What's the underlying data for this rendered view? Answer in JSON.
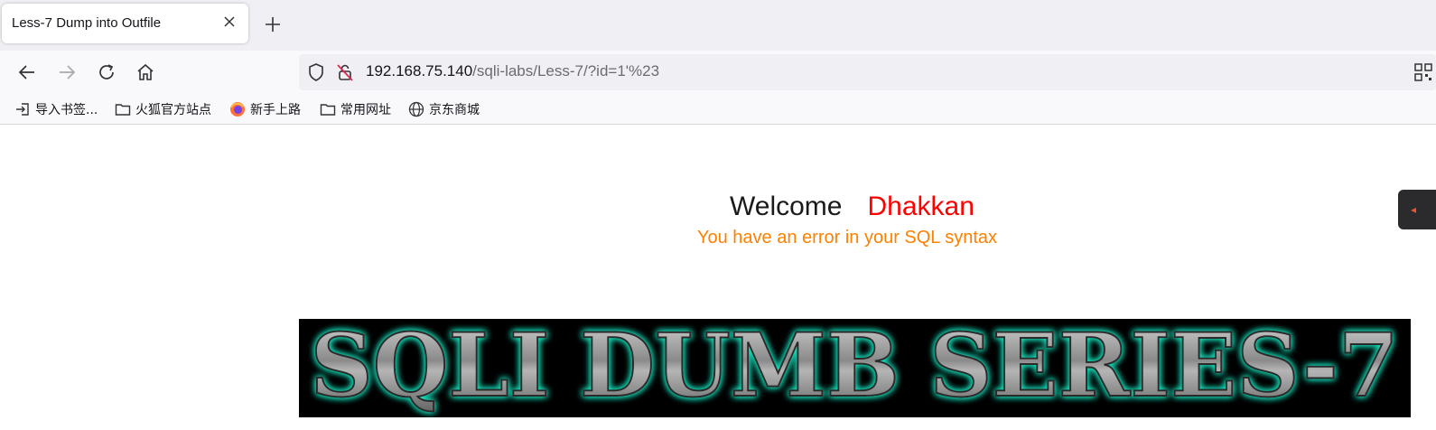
{
  "browser": {
    "tab": {
      "title": "Less-7 Dump into Outfile"
    },
    "url": {
      "host": "192.168.75.140",
      "path": "/sqli-labs/Less-7/?id=1'%23"
    },
    "bookmarks": [
      {
        "label": "导入书签...",
        "icon": "import-icon"
      },
      {
        "label": "火狐官方站点",
        "icon": "folder-icon"
      },
      {
        "label": "新手上路",
        "icon": "firefox-icon"
      },
      {
        "label": "常用网址",
        "icon": "folder-icon"
      },
      {
        "label": "京东商城",
        "icon": "globe-icon"
      }
    ]
  },
  "page": {
    "welcome": "Welcome",
    "name": "Dhakkan",
    "error": "You have an error in your SQL syntax",
    "banner_text": "SQLI DUMB SERIES-7"
  },
  "colors": {
    "name": "#ff0000",
    "error": "#ff8000",
    "banner_glow": "#19e6c0"
  }
}
